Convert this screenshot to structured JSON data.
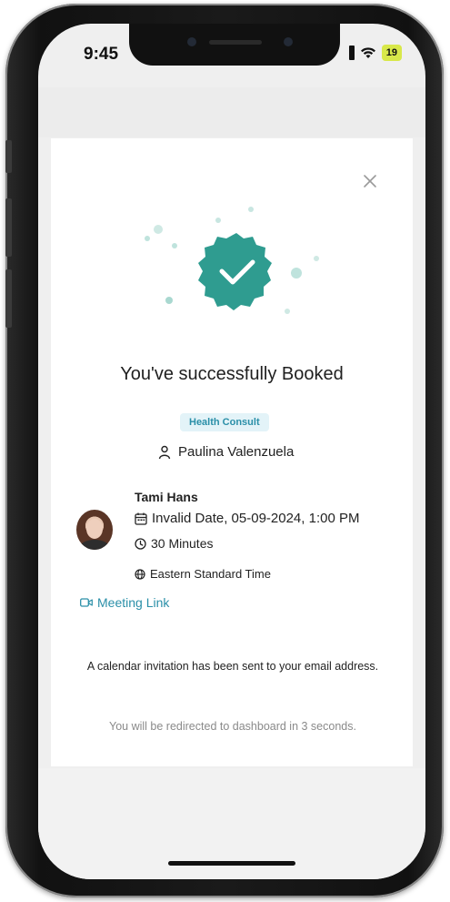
{
  "status_bar": {
    "time": "9:45",
    "battery": "19"
  },
  "booking": {
    "title": "You've successfully Booked",
    "service_tag": "Health Consult",
    "client_name": "Paulina Valenzuela",
    "provider_name": "Tami Hans",
    "date_time": "Invalid Date, 05-09-2024, 1:00 PM",
    "duration": "30 Minutes",
    "timezone": "Eastern Standard Time",
    "meeting_link_label": "Meeting Link",
    "invitation_note": "A calendar invitation has been sent to your email address.",
    "redirect_note": "You will be redirected to dashboard in 3 seconds."
  },
  "colors": {
    "accent": "#2a8fa8",
    "success_badge": "#2f9c90",
    "tag_bg": "#e3f3f8"
  },
  "icons": {
    "close": "close-icon",
    "client": "person-icon",
    "date": "calendar-icon",
    "duration": "clock-icon",
    "timezone": "globe-icon",
    "meeting": "video-icon",
    "success": "check-badge-icon"
  }
}
